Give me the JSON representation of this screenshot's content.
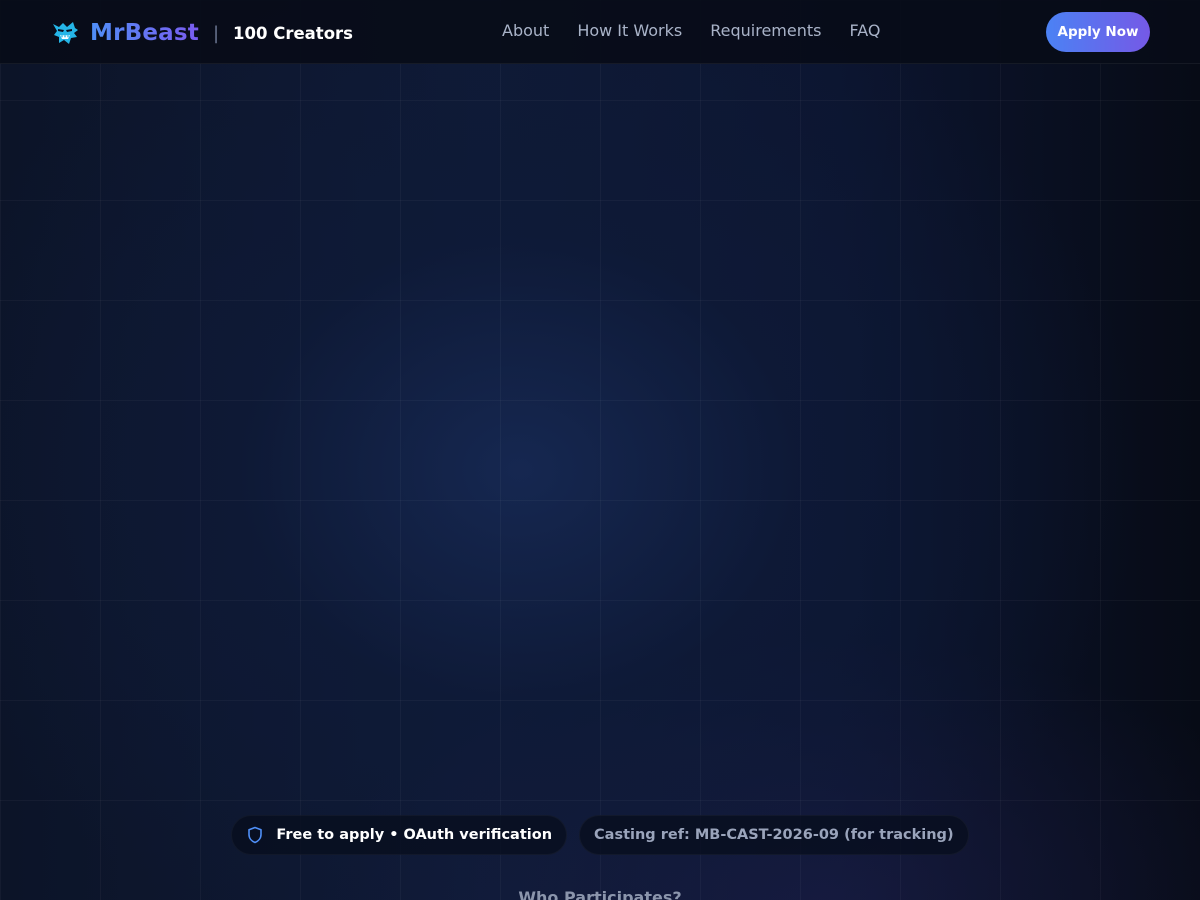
{
  "brand": {
    "name": "MrBeast",
    "separator": "|",
    "subtitle": "100 Creators",
    "logo_icon": "beast-logo-icon",
    "accent_from": "#4f8ff7",
    "accent_to": "#7a5cf0"
  },
  "nav": {
    "links": [
      {
        "label": "About"
      },
      {
        "label": "How It Works"
      },
      {
        "label": "Requirements"
      },
      {
        "label": "FAQ"
      }
    ],
    "cta_label": "Apply Now"
  },
  "badges": {
    "primary": {
      "icon": "shield-icon",
      "text": "Free to apply • OAuth verification"
    },
    "secondary": {
      "text": "Casting ref: MB-CAST-2026-09 (for tracking)"
    }
  },
  "next_section": {
    "title": "Who Participates?"
  }
}
